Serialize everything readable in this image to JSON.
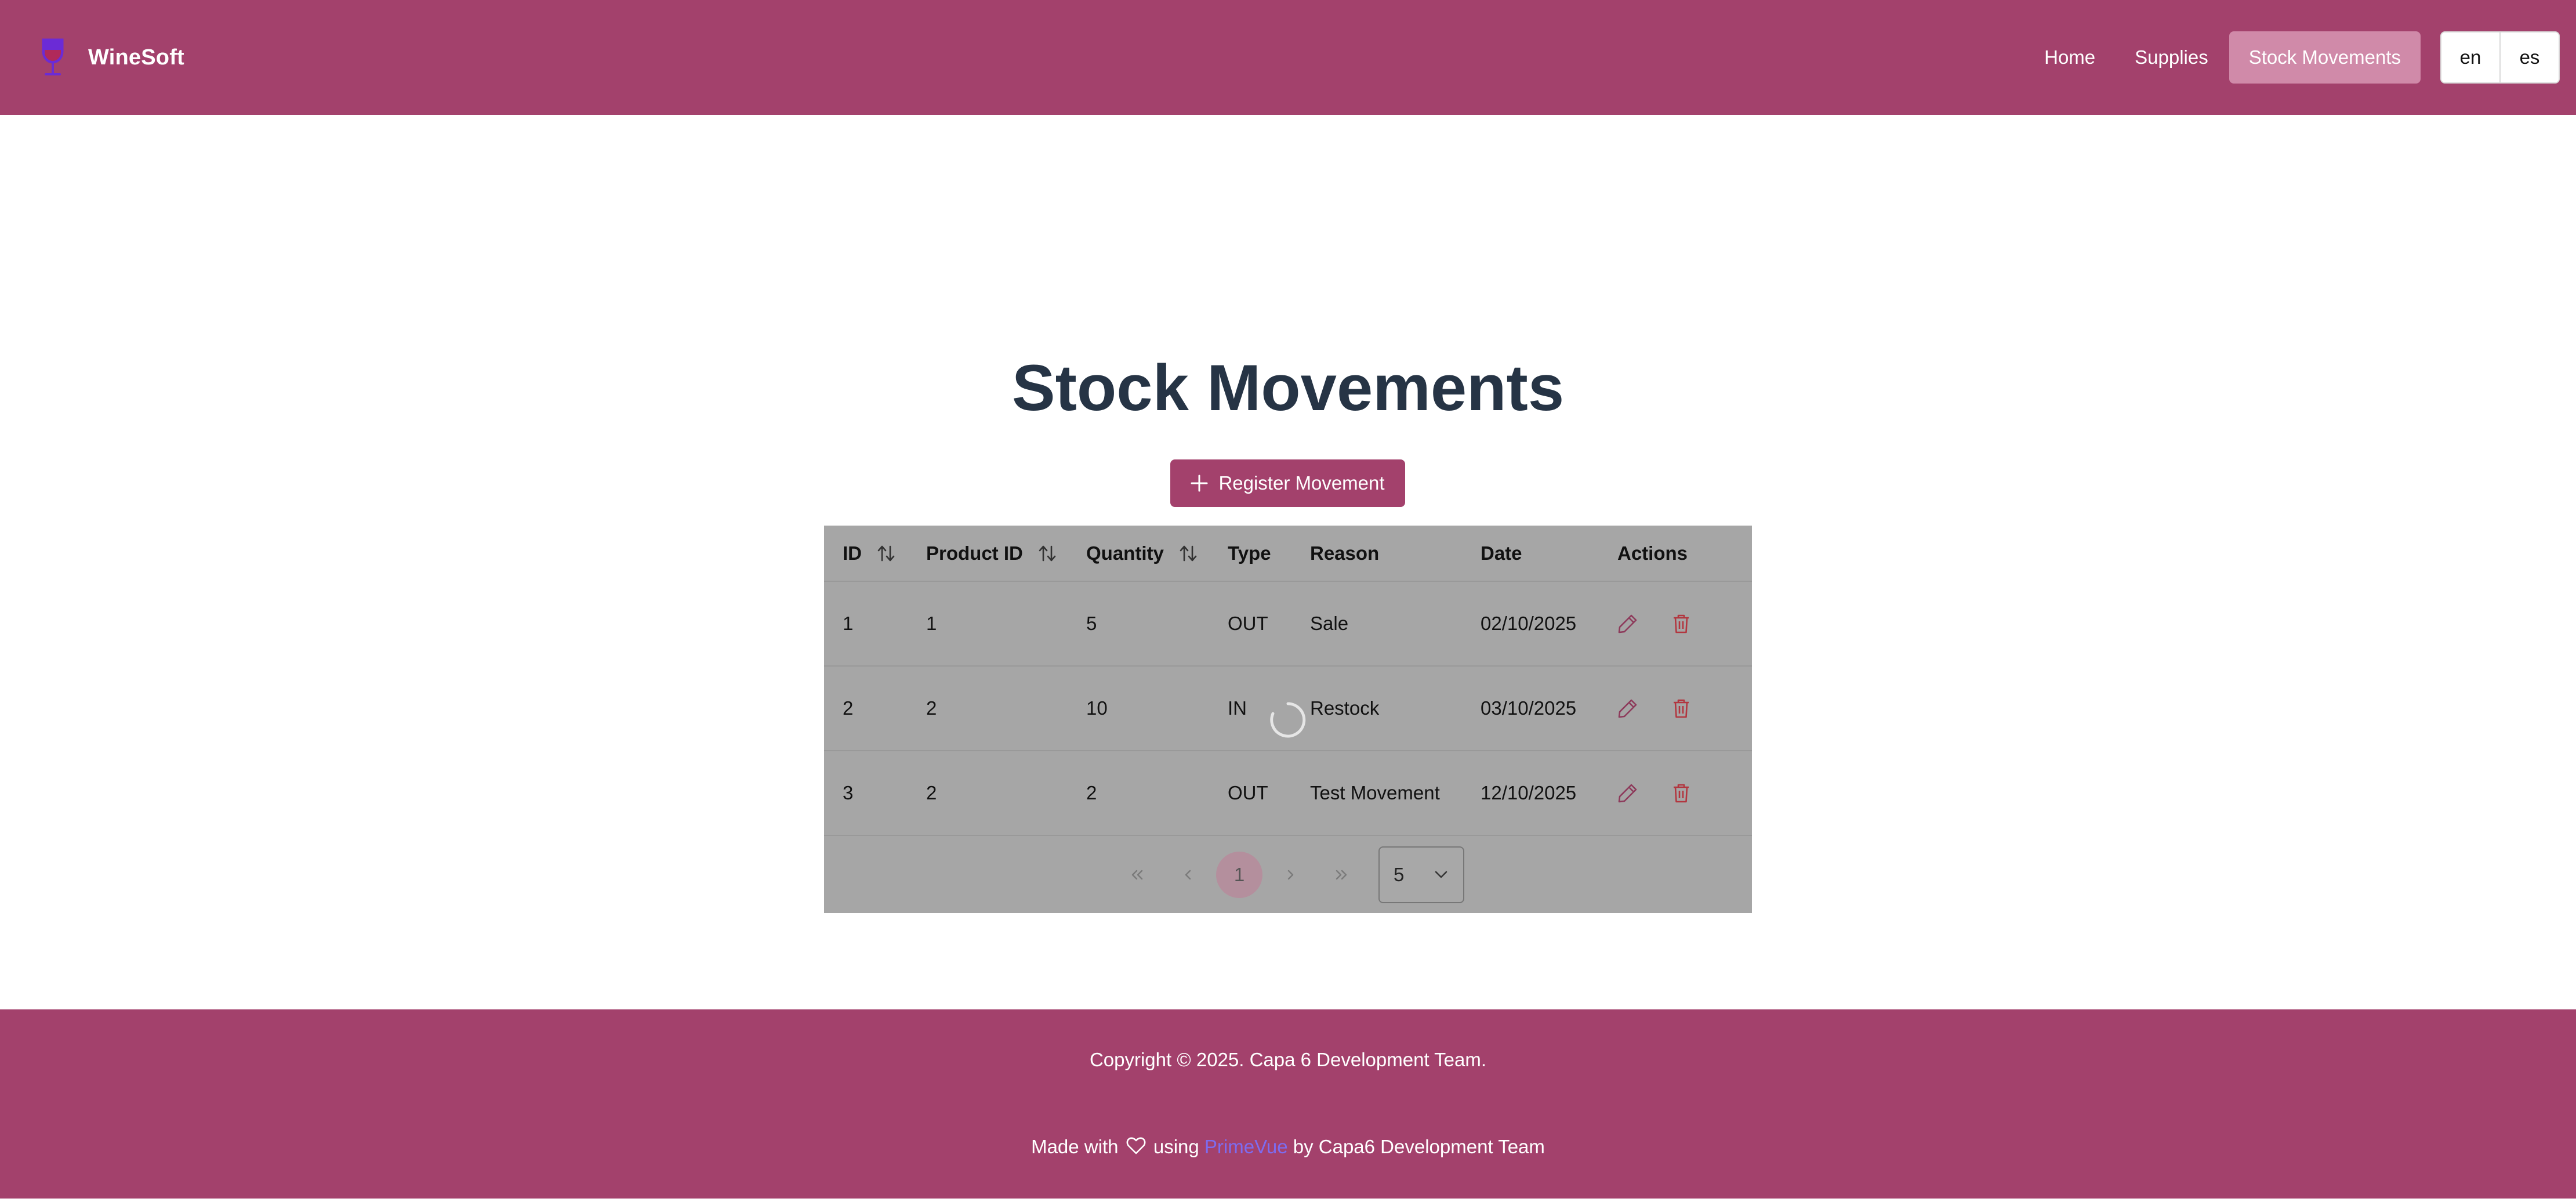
{
  "header": {
    "brand": "WineSoft",
    "nav": [
      {
        "label": "Home",
        "active": false
      },
      {
        "label": "Supplies",
        "active": false
      },
      {
        "label": "Stock Movements",
        "active": true
      }
    ],
    "languages": [
      "en",
      "es"
    ]
  },
  "main": {
    "title": "Stock Movements",
    "register_button": "Register Movement",
    "table": {
      "columns": [
        "ID",
        "Product ID",
        "Quantity",
        "Type",
        "Reason",
        "Date",
        "Actions"
      ],
      "sortable_columns": [
        "ID",
        "Product ID",
        "Quantity"
      ],
      "rows": [
        {
          "id": "1",
          "product_id": "1",
          "quantity": "5",
          "type": "OUT",
          "reason": "Sale",
          "date": "02/10/2025"
        },
        {
          "id": "2",
          "product_id": "2",
          "quantity": "10",
          "type": "IN",
          "reason": "Restock",
          "date": "03/10/2025"
        },
        {
          "id": "3",
          "product_id": "2",
          "quantity": "2",
          "type": "OUT",
          "reason": "Test Movement",
          "date": "12/10/2025"
        }
      ]
    },
    "paginator": {
      "current_page": "1",
      "rows_per_page": "5"
    },
    "loading": true
  },
  "footer": {
    "copyright": "Copyright © 2025. Capa 6 Development Team.",
    "made_with_prefix": "Made with",
    "made_with_using": "using",
    "made_with_link": "PrimeVue",
    "made_with_suffix": "by Capa6 Development Team"
  },
  "colors": {
    "primary": "#a3416c",
    "active_nav": "#d08aa9",
    "overlay": "#a6a6a6",
    "link": "#7d6cf0",
    "title": "#263445"
  },
  "icons": [
    "wine-glass-icon",
    "plus-icon",
    "sort-icon",
    "pencil-icon",
    "trash-icon",
    "double-chevron-left-icon",
    "chevron-left-icon",
    "chevron-right-icon",
    "double-chevron-right-icon",
    "chevron-down-icon",
    "heart-icon",
    "spinner-icon"
  ]
}
